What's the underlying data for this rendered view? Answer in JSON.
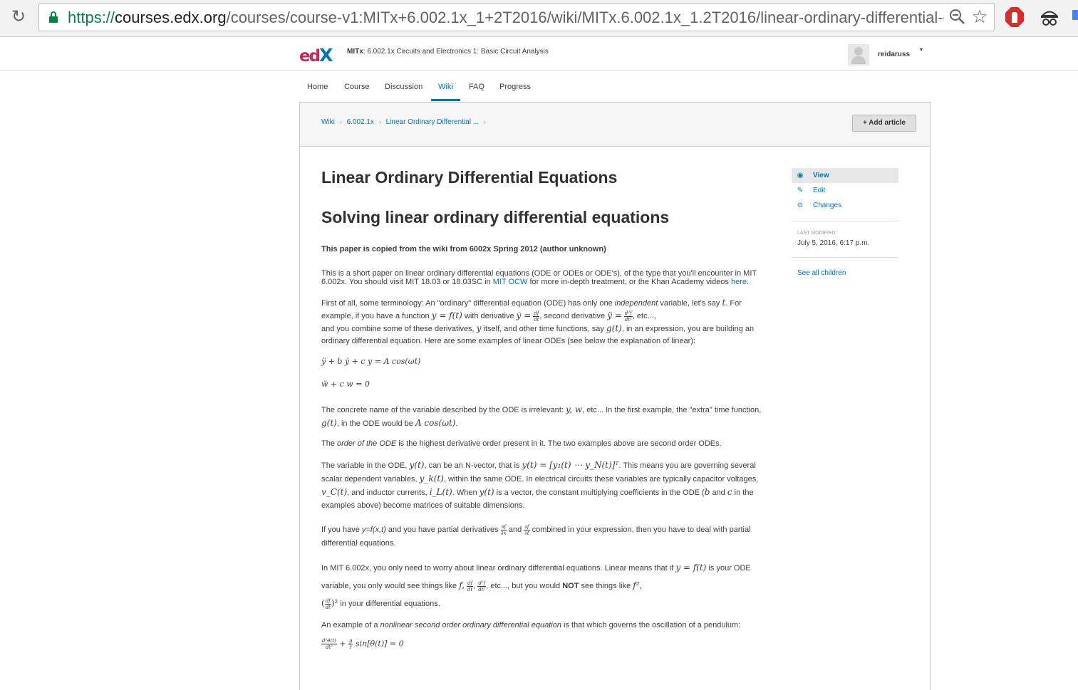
{
  "browser": {
    "url_scheme": "https://",
    "url_host": "courses.edx.org",
    "url_path": "/courses/course-v1:MITx+6.002.1x_1+2T2016/wiki/MITx.6.002.1x_1.2T2016/linear-ordinary-differential-equatic"
  },
  "header": {
    "logo_e": "e",
    "logo_d": "d",
    "logo_x": "X",
    "course_org": "MITx",
    "course_name": ": 6.002.1x Circuits and Electronics 1: Basic Circuit Analysis",
    "username": "reidaruss",
    "user_menu_caret": "▾"
  },
  "tabs": [
    {
      "label": "Home"
    },
    {
      "label": "Course"
    },
    {
      "label": "Discussion"
    },
    {
      "label": "Wiki",
      "active": true
    },
    {
      "label": "FAQ"
    },
    {
      "label": "Progress"
    }
  ],
  "breadcrumb": [
    "Wiki",
    "6.002.1x",
    "Linear Ordinary Differential ..."
  ],
  "breadcrumb_sep": "›",
  "add_article": "+ Add article",
  "sidebar": {
    "items": [
      {
        "label": "View",
        "icon": "eye-icon",
        "glyph": "◉"
      },
      {
        "label": "Edit",
        "icon": "pencil-icon",
        "glyph": "✎"
      },
      {
        "label": "Changes",
        "icon": "clock-icon",
        "glyph": "⊙"
      }
    ],
    "last_modified_label": "LAST MODIFIED:",
    "last_modified_value": "July 5, 2016, 6:17 p.m.",
    "see_all_children": "See all children"
  },
  "article": {
    "title": "Linear Ordinary Differential Equations",
    "subtitle": "Solving linear ordinary differential equations",
    "note": "This paper is copied from the wiki from 6002x Spring 2012 (author unknown)",
    "p1_a": "This is a short paper on linear ordinary differential equations (ODE or ODEs or ODE's), of the type that you'll encounter in MIT 6.002x. You should visit MIT 18.03 or 18.03SC in ",
    "p1_link1": "MIT OCW",
    "p1_b": " for more in-depth treatment, or the Khan Academy videos ",
    "p1_link2": "here",
    "p1_c": ".",
    "p2_a": "First of all, some terminology: An \"ordinary\" differential equation (ODE) has only one ",
    "p2_em": "independent",
    "p2_b": " variable, let's say ",
    "p2_c": ". For example, if you have a function ",
    "p2_d": " with derivative ",
    "p2_e": ", second derivative ",
    "p2_f": ", etc...,",
    "p2_g": "and you combine some of these derivatives, ",
    "p2_h": " itself, and other time functions, say ",
    "p2_i": ", in an expression, you are building an ordinary differential equation. Here are some examples of linear ODEs (see below the explanation of linear):",
    "eq1": "ÿ + b ẏ + c y = A cos(ωt)",
    "eq2": "ẅ + c w = 0",
    "p3_a": "The concrete name of the variable described by the ODE is irrelevant: ",
    "p3_b": ", etc... In the first example, the \"extra\" time function, ",
    "p3_c": ", in the ODE would be ",
    "p3_d": ".",
    "p4_a": "The ",
    "p4_em": "order of the ODE",
    "p4_b": " is the highest derivative order present in it. The two examples above are second order ODEs.",
    "p5_a": "The variable in the ODE, ",
    "p5_b": ", can be an N-vector, that is ",
    "p5_c": ". This means you are governing several scalar dependent variables, ",
    "p5_d": ", within the same ODE. In electrical circuits these variables are typically capacitor voltages, ",
    "p5_e": ", and inductor currents, ",
    "p5_f": ". When ",
    "p5_g": " is a vector, the constant multiplying coefficients in the ODE (",
    "p5_h": " and ",
    "p5_i": " in the examples above) become matrices of suitable dimensions.",
    "p6_a": "If you have ",
    "p6_em": "y=f(x,t)",
    "p6_b": " and you have partial derivatives ",
    "p6_c": " and ",
    "p6_d": " combined in your expression, then you have to deal with partial differential equations.",
    "p7_a": "In MIT 6.002x, you only need to worry about linear ordinary differential equations. Linear means that if ",
    "p7_b": " is your ODE variable, you only would see things like ",
    "p7_c": ", etc..., but you would ",
    "p7_not": "NOT",
    "p7_d": " see things like ",
    "p7_e": " in your differential equations.",
    "p8_a": "An example of a ",
    "p8_em": "nonlinear second order ordinary differential equation",
    "p8_b": " is that which governs the oscillation of a pendulum:",
    "eq3_tail": "+ ",
    "eq3_end": " sin[θ(t)] = 0",
    "math": {
      "t": "t",
      "y_eq_f": "y = f(t)",
      "ydot_eq": "ẏ =",
      "yddot_eq": "ÿ =",
      "y": "y",
      "g": "g(t)",
      "yw": "y, w",
      "gt": "g(t)",
      "acos": "A cos(ωt)",
      "yt": "y(t)",
      "yvec": "y(t) = [y₁(t) ⋯ y_N(t)]ᵀ",
      "yk": "y_k(t)",
      "vc": "v_C(t)",
      "il": "i_L(t)",
      "yt2": "y(t)",
      "b": "b",
      "c": "c",
      "yf": "y = f(t)",
      "f": "f,",
      "f2": "f²,",
      "dfdt2": "(",
      "dfdt2_close": ")²",
      "frac_df": "df",
      "frac_dt": "dt",
      "frac_d2f": "d²f",
      "frac_dt2": "dt²",
      "frac_pf": "∂f",
      "frac_px": "∂x",
      "frac_pt": "∂t",
      "frac_d2theta": "d²θ(t)",
      "frac_g": "g",
      "frac_l": "ℓ"
    }
  }
}
